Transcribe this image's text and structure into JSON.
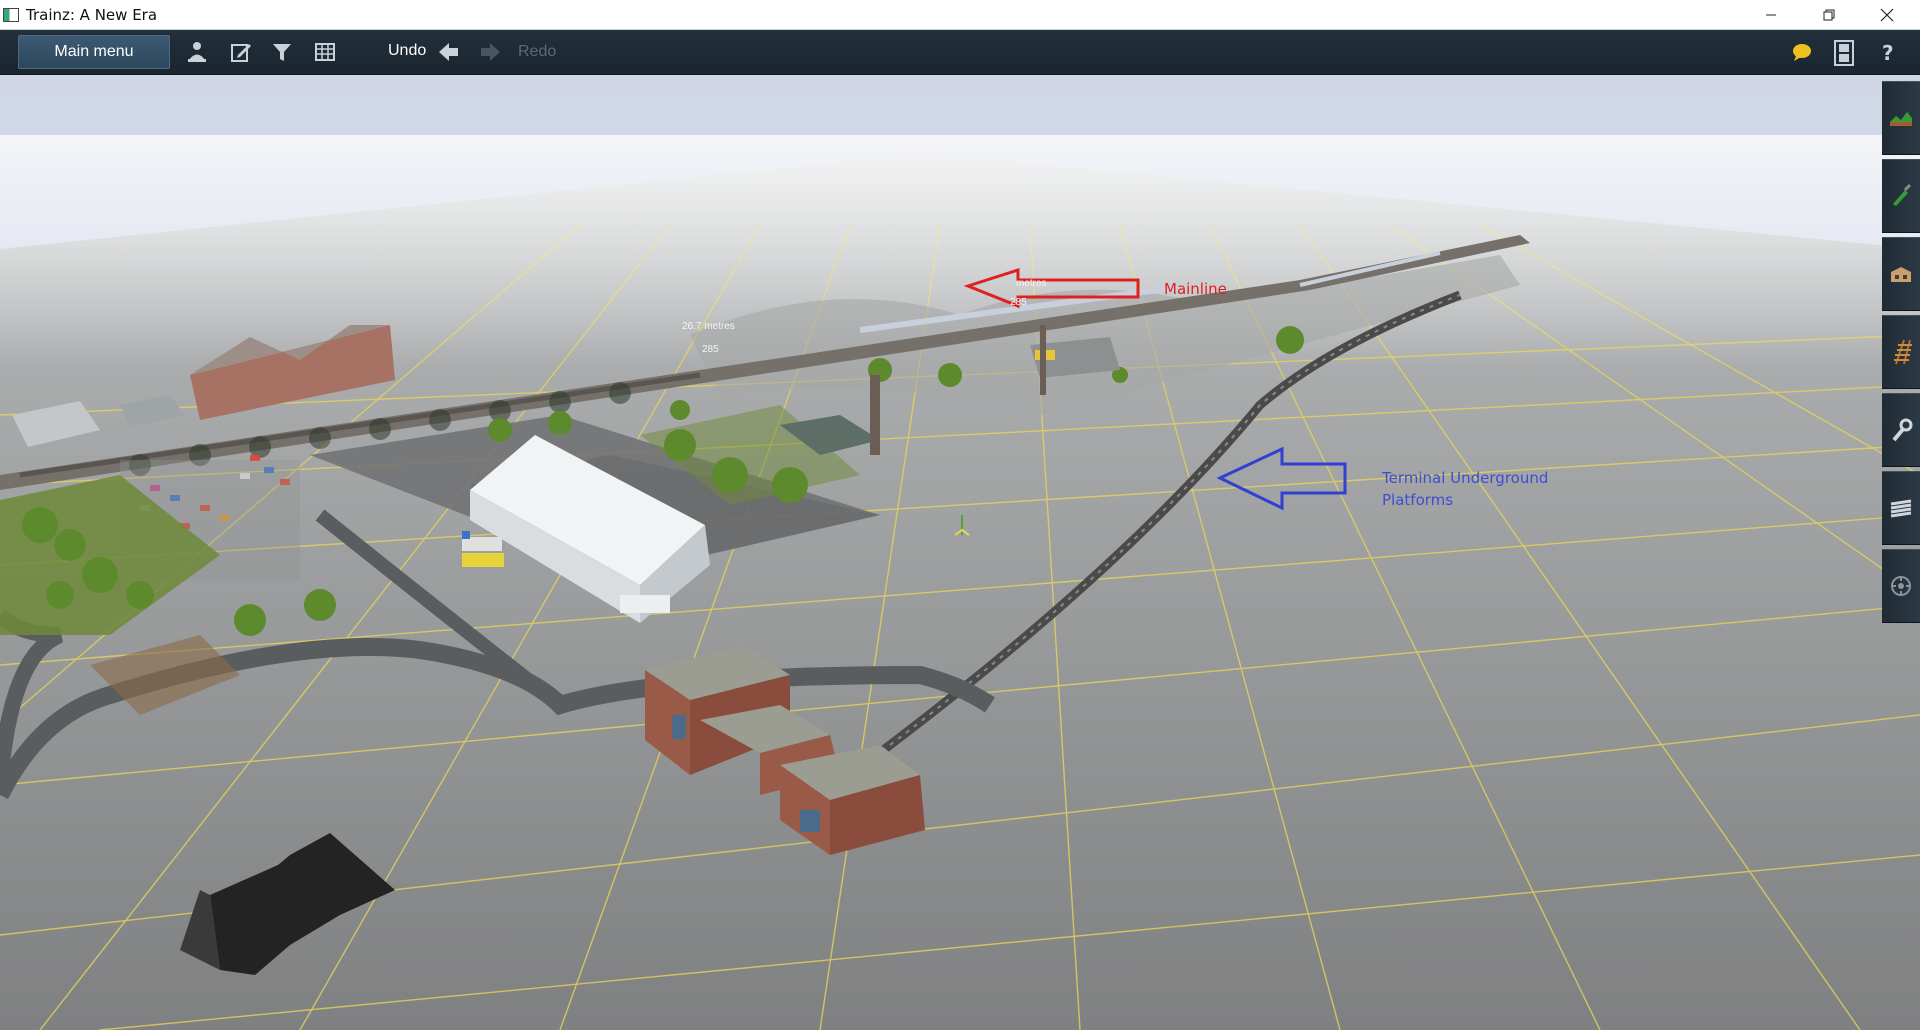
{
  "window": {
    "title": "Trainz: A New Era"
  },
  "toolbar": {
    "main_menu_label": "Main menu",
    "icons": [
      "driver-icon",
      "edit-icon",
      "filter-icon",
      "grid-icon"
    ],
    "undo_label": "Undo",
    "redo_label": "Redo",
    "right_icons": [
      "chat-icon",
      "film-icon",
      "help-icon"
    ]
  },
  "sidebar": {
    "tools": [
      "terrain-tool",
      "paint-tool",
      "objects-tool",
      "track-tool",
      "trackside-tool",
      "layers-tool",
      "session-tool"
    ]
  },
  "scene": {
    "annotations": {
      "mainline": "Mainline",
      "terminal_line1": "Terminal Underground",
      "terminal_line2": "Platforms"
    },
    "distance_labels": [
      "metres",
      "285",
      "26.7 metres",
      "285"
    ]
  },
  "colors": {
    "toolbar_bg": "#1c2731",
    "mainline_arrow": "#e02020",
    "terminal_arrow": "#3040d0",
    "grid_line": "#e6d45a",
    "ground": "#8c8d8c"
  }
}
